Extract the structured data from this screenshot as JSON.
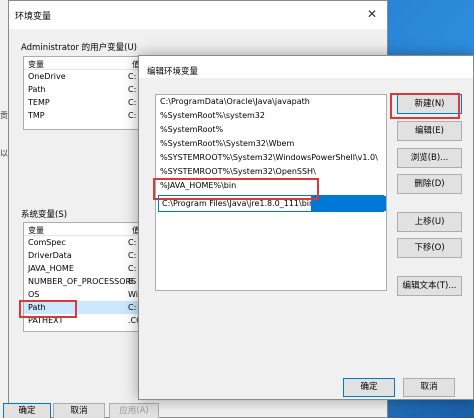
{
  "env_dialog": {
    "title": "环境变量",
    "close_glyph": "✕",
    "user_section_label": "Administrator 的用户变量(U)",
    "user_table": {
      "headers": [
        "变量",
        "值"
      ],
      "rows": [
        {
          "name": "OneDrive",
          "value": "C:"
        },
        {
          "name": "Path",
          "value": "C:"
        },
        {
          "name": "TEMP",
          "value": "C:"
        },
        {
          "name": "TMP",
          "value": "C:"
        }
      ]
    },
    "system_section_label": "系统变量(S)",
    "system_table": {
      "headers": [
        "变量",
        "值"
      ],
      "rows": [
        {
          "name": "ComSpec",
          "value": "C:"
        },
        {
          "name": "DriverData",
          "value": "C:"
        },
        {
          "name": "JAVA_HOME",
          "value": "C:"
        },
        {
          "name": "NUMBER_OF_PROCESSORS",
          "value": "8"
        },
        {
          "name": "OS",
          "value": "Wir"
        },
        {
          "name": "Path",
          "value": "C:"
        },
        {
          "name": "PATHEXT",
          "value": ".CC"
        }
      ]
    },
    "ok_label": "确定",
    "cancel_label": "取消",
    "apply_label": "应用(A)",
    "left_fragment_1": "贡",
    "left_fragment_2": "以"
  },
  "edit_dialog": {
    "title": "编辑环境变量",
    "paths": [
      "C:\\ProgramData\\Oracle\\Java\\javapath",
      "%SystemRoot%\\system32",
      "%SystemRoot%",
      "%SystemRoot%\\System32\\Wbem",
      "%SYSTEMROOT%\\System32\\WindowsPowerShell\\v1.0\\",
      "%SYSTEMROOT%\\System32\\OpenSSH\\",
      "%JAVA_HOME%\\bin"
    ],
    "editing_value": "C:\\Program Files\\Java\\jre1.8.0_111\\bin",
    "buttons": {
      "new": "新建(N)",
      "edit": "编辑(E)",
      "browse": "浏览(B)...",
      "delete": "删除(D)",
      "move_up": "上移(U)",
      "move_down": "下移(O)",
      "edit_text": "编辑文本(T)..."
    },
    "ok_label": "确定",
    "cancel_label": "取消"
  },
  "highlight_color": "#d83a3a",
  "accent_color": "#0078d7"
}
